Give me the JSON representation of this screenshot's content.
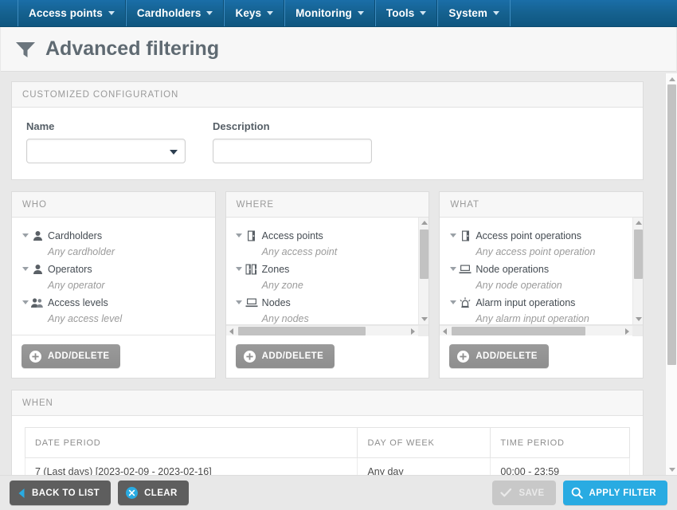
{
  "nav": {
    "items": [
      {
        "label": "Access points",
        "icon": "chevron-down-icon"
      },
      {
        "label": "Cardholders",
        "icon": "chevron-down-icon"
      },
      {
        "label": "Keys",
        "icon": "chevron-down-icon"
      },
      {
        "label": "Monitoring",
        "icon": "chevron-down-icon"
      },
      {
        "label": "Tools",
        "icon": "chevron-down-icon"
      },
      {
        "label": "System",
        "icon": "chevron-down-icon"
      }
    ]
  },
  "header": {
    "title": "Advanced filtering",
    "icon": "filter-funnel-icon"
  },
  "customized_configuration": {
    "title": "CUSTOMIZED CONFIGURATION",
    "name": {
      "label": "Name",
      "value": "",
      "icon": "chevron-down-icon"
    },
    "description": {
      "label": "Description",
      "value": "",
      "placeholder": ""
    }
  },
  "who": {
    "title": "WHO",
    "nodes": [
      {
        "label": "Cardholders",
        "icon": "person-icon",
        "child": "Any cardholder",
        "toggle": "caret-down-icon"
      },
      {
        "label": "Operators",
        "icon": "person-icon",
        "child": "Any operator",
        "toggle": "caret-down-icon"
      },
      {
        "label": "Access levels",
        "icon": "people-group-icon",
        "child": "Any access level",
        "toggle": "caret-down-icon"
      }
    ],
    "add_delete_label": "ADD/DELETE",
    "add_delete_icon": "plus-circle-icon"
  },
  "where": {
    "title": "WHERE",
    "nodes": [
      {
        "label": "Access points",
        "icon": "door-icon",
        "child": "Any access point",
        "toggle": "caret-down-icon"
      },
      {
        "label": "Zones",
        "icon": "double-door-icon",
        "child": "Any zone",
        "toggle": "caret-down-icon"
      },
      {
        "label": "Nodes",
        "icon": "monitor-icon",
        "child": "Any nodes",
        "toggle": "caret-down-icon"
      }
    ],
    "add_delete_label": "ADD/DELETE",
    "add_delete_icon": "plus-circle-icon"
  },
  "what": {
    "title": "WHAT",
    "nodes": [
      {
        "label": "Access point operations",
        "icon": "door-icon",
        "child": "Any access point operation",
        "toggle": "caret-down-icon"
      },
      {
        "label": "Node operations",
        "icon": "monitor-icon",
        "child": "Any node operation",
        "toggle": "caret-down-icon"
      },
      {
        "label": "Alarm input operations",
        "icon": "alarm-siren-icon",
        "child": "Any alarm input operation",
        "toggle": "caret-down-icon"
      }
    ],
    "add_delete_label": "ADD/DELETE",
    "add_delete_icon": "plus-circle-icon"
  },
  "when": {
    "title": "WHEN",
    "columns": [
      "DATE PERIOD",
      "DAY OF WEEK",
      "TIME PERIOD"
    ],
    "rows": [
      [
        "7 (Last days) [2023-02-09 - 2023-02-16]",
        "Any day",
        "00:00 - 23:59"
      ]
    ]
  },
  "footer": {
    "back_label": "BACK TO LIST",
    "back_icon": "chevron-left-icon",
    "clear_label": "CLEAR",
    "clear_icon": "x-circle-icon",
    "save_label": "SAVE",
    "save_icon": "check-icon",
    "apply_label": "APPLY FILTER",
    "apply_icon": "search-icon"
  },
  "colors": {
    "nav_blue": "#15618f",
    "accent_blue": "#29abe2",
    "button_gray": "#8e8e8e",
    "button_dark": "#5e5e5e",
    "disabled_gray": "#c8c8c8",
    "page_bg": "#e8e8e8"
  }
}
